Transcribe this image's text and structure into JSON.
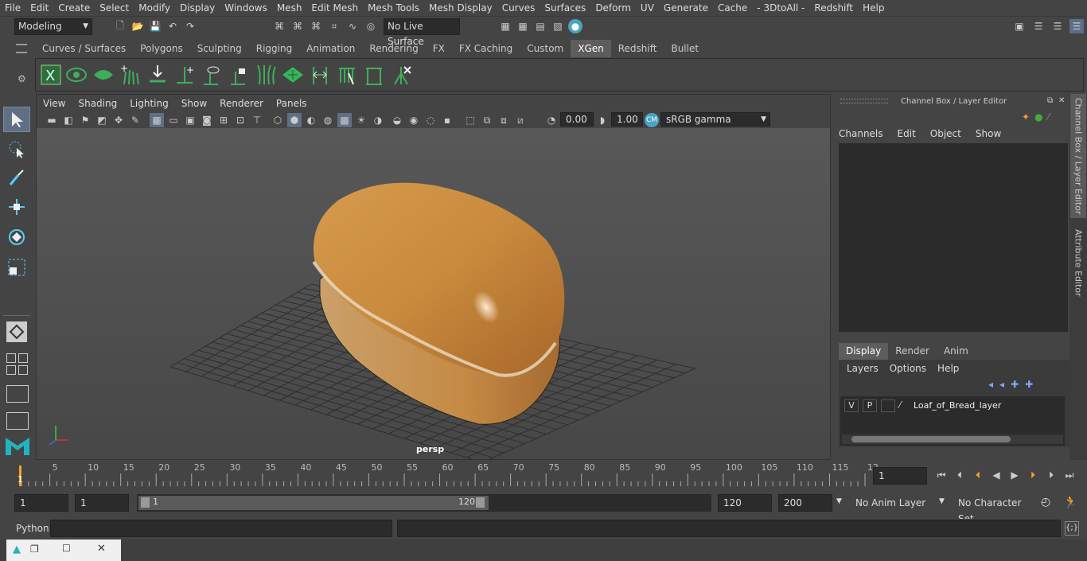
{
  "menubar": {
    "items": [
      "File",
      "Edit",
      "Create",
      "Select",
      "Modify",
      "Display",
      "Windows",
      "Mesh",
      "Edit Mesh",
      "Mesh Tools",
      "Mesh Display",
      "Curves",
      "Surfaces",
      "Deform",
      "UV",
      "Generate",
      "Cache",
      "- 3DtoAll -",
      "Redshift",
      "Help"
    ]
  },
  "statusline": {
    "mode": "Modeling",
    "live_surface": "No Live Surface"
  },
  "shelf": {
    "tabs": [
      "Curves / Surfaces",
      "Polygons",
      "Sculpting",
      "Rigging",
      "Animation",
      "Rendering",
      "FX",
      "FX Caching",
      "Custom",
      "XGen",
      "Redshift",
      "Bullet"
    ],
    "active_tab": "XGen"
  },
  "viewport": {
    "menu": [
      "View",
      "Shading",
      "Lighting",
      "Show",
      "Renderer",
      "Panels"
    ],
    "exposure": "0.00",
    "gamma": "1.00",
    "color_space": "sRGB gamma",
    "camera_label": "persp"
  },
  "channel_box": {
    "title": "Channel Box / Layer Editor",
    "menu": [
      "Channels",
      "Edit",
      "Object",
      "Show"
    ]
  },
  "layer_editor": {
    "tabs": [
      "Display",
      "Render",
      "Anim"
    ],
    "active_tab": "Display",
    "menu": [
      "Layers",
      "Options",
      "Help"
    ],
    "layers": [
      {
        "v": "V",
        "p": "P",
        "name": "Loaf_of_Bread_layer"
      }
    ]
  },
  "side_tabs": [
    "Channel Box / Layer Editor",
    "Attribute Editor"
  ],
  "timeline": {
    "ticks": [
      "5",
      "10",
      "15",
      "20",
      "25",
      "30",
      "35",
      "40",
      "45",
      "50",
      "55",
      "60",
      "65",
      "70",
      "75",
      "80",
      "85",
      "90",
      "95",
      "100",
      "105",
      "110",
      "115",
      "12"
    ],
    "current_frame_marker": "1",
    "current_frame": "1"
  },
  "range": {
    "start": "1",
    "playback_start": "1",
    "slider_start": "1",
    "slider_end": "120",
    "playback_end": "120",
    "end": "200",
    "anim_layer": "No Anim Layer",
    "character_set": "No Character Set"
  },
  "cmdline": {
    "label": "Python"
  },
  "colors": {
    "accent": "#5d5d5d",
    "selected_tool": "#5f6f85",
    "bread": "#c98a3a",
    "xgen_green": "#3fae5a"
  }
}
